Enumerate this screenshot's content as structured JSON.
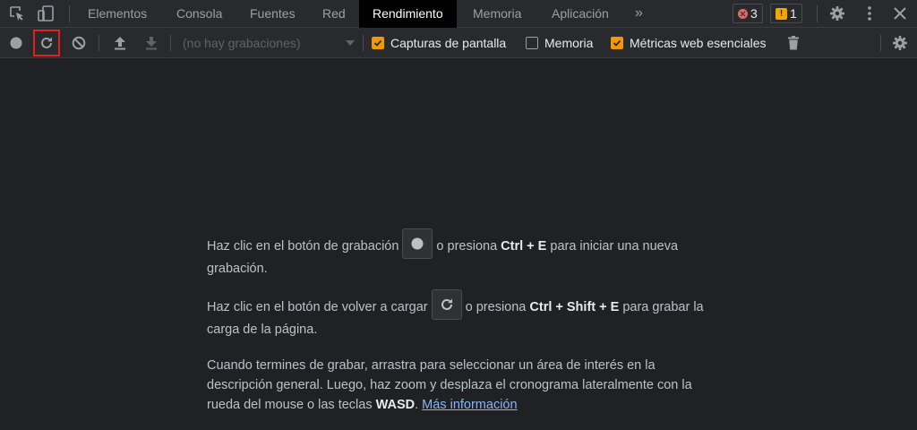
{
  "tabs": [
    {
      "label": "Elementos",
      "active": false
    },
    {
      "label": "Consola",
      "active": false
    },
    {
      "label": "Fuentes",
      "active": false
    },
    {
      "label": "Red",
      "active": false
    },
    {
      "label": "Rendimiento",
      "active": true
    },
    {
      "label": "Memoria",
      "active": false
    },
    {
      "label": "Aplicación",
      "active": false
    }
  ],
  "more_tabs_label": "»",
  "counters": {
    "errors": "3",
    "warnings": "1"
  },
  "toolbar": {
    "recordings_placeholder": "(no hay grabaciones)",
    "checkboxes": [
      {
        "label": "Capturas de pantalla",
        "checked": true
      },
      {
        "label": "Memoria",
        "checked": false
      },
      {
        "label": "Métricas web esenciales",
        "checked": true
      }
    ]
  },
  "landing": {
    "p1_before": "Haz clic en el botón de grabación",
    "p1_mid": "o presiona",
    "p1_key": "Ctrl + E",
    "p1_after": "para iniciar una nueva grabación.",
    "p2_before": "Haz clic en el botón de volver a cargar",
    "p2_mid": "o presiona",
    "p2_key": "Ctrl + Shift + E",
    "p2_after": "para grabar la carga de la página.",
    "p3_text": "Cuando termines de grabar, arrastra para seleccionar un área de interés en la descripción general. Luego, haz zoom y desplaza el cronograma lateralmente con la rueda del mouse o las teclas",
    "p3_key": "WASD",
    "p3_sep": ".",
    "p3_link": "Más información"
  },
  "colors": {
    "accent": "#f29900",
    "highlight_box": "#e0201d",
    "link": "#8ab4f8",
    "background": "#202124",
    "active_tab_bg": "#000000"
  },
  "icons": [
    "inspect-element-icon",
    "device-toolbar-icon",
    "record-icon",
    "reload-icon",
    "clear-icon",
    "upload-icon",
    "download-icon",
    "trash-icon",
    "settings-icon",
    "more-vertical-icon",
    "close-icon",
    "error-icon",
    "warning-icon"
  ]
}
